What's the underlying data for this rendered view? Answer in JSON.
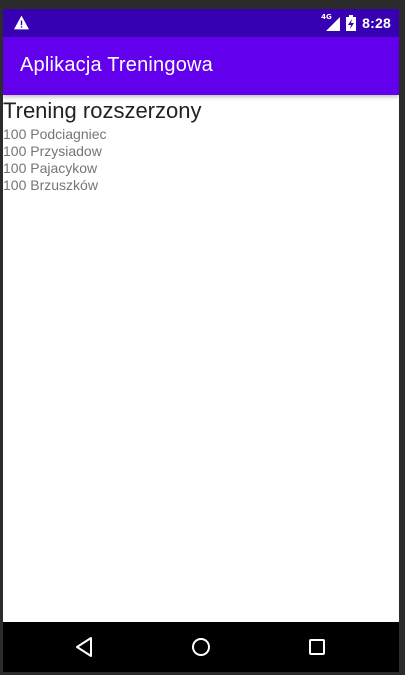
{
  "status_bar": {
    "time": "8:28",
    "network": "4G",
    "warning_icon": "warning-icon",
    "signal_icon": "signal-icon",
    "battery_icon": "battery-charging-icon"
  },
  "app_bar": {
    "title": "Aplikacja Treningowa"
  },
  "main": {
    "heading": "Trening rozszerzony",
    "exercises": [
      "100 Podciagniec",
      "100 Przysiadow",
      "100 Pajacykow",
      "100 Brzuszków"
    ]
  },
  "nav_bar": {
    "back_icon": "back-triangle-icon",
    "home_icon": "home-circle-icon",
    "recents_icon": "recents-square-icon"
  },
  "colors": {
    "status_bar": "#3700b3",
    "app_bar": "#6200ee",
    "heading_text": "#222222",
    "list_text": "#757575",
    "nav_bar": "#000000"
  }
}
